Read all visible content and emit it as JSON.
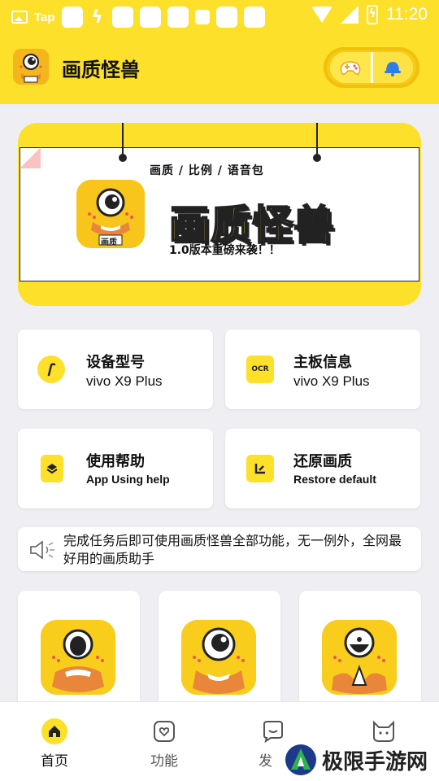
{
  "status_bar": {
    "time": "11:20",
    "app_label": "Tap"
  },
  "header": {
    "title": "画质怪兽"
  },
  "banner": {
    "tags": "画质 / 比例 / 语音包",
    "headline": "画质怪兽",
    "tagline": "1.0版本重磅来袭！！",
    "icon_label": "画质"
  },
  "cards": [
    {
      "title": "设备型号",
      "subtitle": "vivo X9 Plus",
      "icon": "pen-icon"
    },
    {
      "title": "主板信息",
      "subtitle": "vivo X9 Plus",
      "icon": "ocr-icon",
      "icon_text": "OCR"
    },
    {
      "title": "使用帮助",
      "subtitle": "App Using help",
      "icon": "document-layers-icon"
    },
    {
      "title": "还原画质",
      "subtitle": "Restore default",
      "icon": "restore-icon"
    }
  ],
  "notice": {
    "text": "完成任务后即可使用画质怪兽全部功能，无一例外，全网最好用的画质助手"
  },
  "bottom_nav": [
    {
      "label": "首页",
      "icon": "home-icon",
      "active": true
    },
    {
      "label": "功能",
      "icon": "heart-tag-icon",
      "active": false
    },
    {
      "label": "发",
      "icon": "chat-icon",
      "active": false
    },
    {
      "label": "",
      "icon": "cat-icon",
      "active": false
    }
  ],
  "watermark": {
    "text": "极限手游网"
  },
  "colors": {
    "accent": "#fde02a",
    "background": "#efeef3",
    "card": "#ffffff"
  }
}
